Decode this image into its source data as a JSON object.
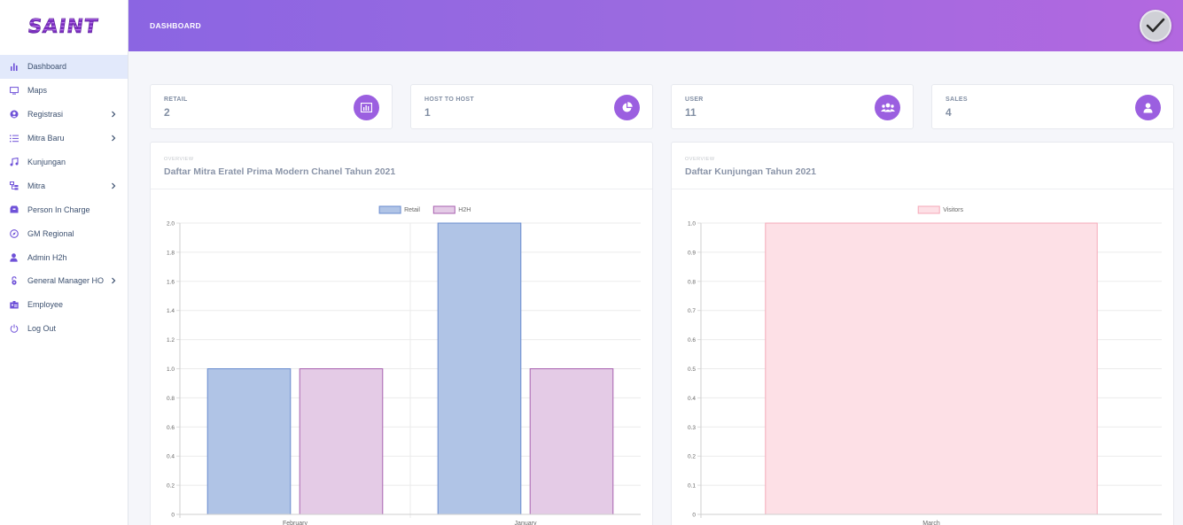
{
  "brand": "SAINT",
  "header": {
    "title": "DASHBOARD"
  },
  "sidebar": {
    "items": [
      {
        "label": "Dashboard",
        "icon": "bar-chart-icon",
        "active": true,
        "has_submenu": false
      },
      {
        "label": "Maps",
        "icon": "monitor-icon",
        "active": false,
        "has_submenu": false
      },
      {
        "label": "Registrasi",
        "icon": "user-circle-icon",
        "active": false,
        "has_submenu": true
      },
      {
        "label": "Mitra Baru",
        "icon": "list-icon",
        "active": false,
        "has_submenu": true
      },
      {
        "label": "Kunjungan",
        "icon": "music-note-icon",
        "active": false,
        "has_submenu": false
      },
      {
        "label": "Mitra",
        "icon": "hierarchy-icon",
        "active": false,
        "has_submenu": true
      },
      {
        "label": "Person In Charge",
        "icon": "inbox-icon",
        "active": false,
        "has_submenu": false
      },
      {
        "label": "GM Regional",
        "icon": "compass-icon",
        "active": false,
        "has_submenu": false
      },
      {
        "label": "Admin H2h",
        "icon": "user-icon",
        "active": false,
        "has_submenu": false
      },
      {
        "label": "General Manager HO",
        "icon": "lock-icon",
        "active": false,
        "has_submenu": true
      },
      {
        "label": "Employee",
        "icon": "id-card-icon",
        "active": false,
        "has_submenu": false
      },
      {
        "label": "Log Out",
        "icon": "power-icon",
        "active": false,
        "has_submenu": false
      }
    ]
  },
  "stats": [
    {
      "label": "RETAIL",
      "value": "2",
      "icon": "bar-chart-icon"
    },
    {
      "label": "HOST TO HOST",
      "value": "1",
      "icon": "pie-chart-icon"
    },
    {
      "label": "USER",
      "value": "11",
      "icon": "users-icon"
    },
    {
      "label": "SALES",
      "value": "4",
      "icon": "user-icon"
    }
  ],
  "cards": [
    {
      "overline": "OVERVIEW",
      "title": "Daftar Mitra Eratel Prima Modern Chanel Tahun 2021"
    },
    {
      "overline": "OVERVIEW",
      "title": "Daftar Kunjungan Tahun 2021"
    }
  ],
  "colors": {
    "accent": "#9b5fe0",
    "retail_fill": "#b0c4e6",
    "retail_stroke": "#6a8ccf",
    "h2h_fill": "#e4cbe6",
    "h2h_stroke": "#a862b0",
    "visitors_fill": "#fde0e6",
    "visitors_stroke": "#f5a9b8"
  },
  "chart_data": [
    {
      "type": "bar",
      "categories": [
        "February",
        "January"
      ],
      "series": [
        {
          "name": "Retail",
          "values": [
            1,
            2
          ]
        },
        {
          "name": "H2H",
          "values": [
            1,
            1
          ]
        }
      ],
      "ylim": [
        0,
        2
      ],
      "yticks": [
        "0",
        "0.2",
        "0.4",
        "0.6",
        "0.8",
        "1.0",
        "1.2",
        "1.4",
        "1.6",
        "1.8",
        "2.0"
      ],
      "legend": "top-center",
      "grid": true
    },
    {
      "type": "bar",
      "categories": [
        "March"
      ],
      "series": [
        {
          "name": "Visitors",
          "values": [
            1
          ]
        }
      ],
      "ylim": [
        0,
        1
      ],
      "yticks": [
        "0",
        "0.1",
        "0.2",
        "0.3",
        "0.4",
        "0.5",
        "0.6",
        "0.7",
        "0.8",
        "0.9",
        "1.0"
      ],
      "legend": "top-center",
      "grid": true
    }
  ]
}
